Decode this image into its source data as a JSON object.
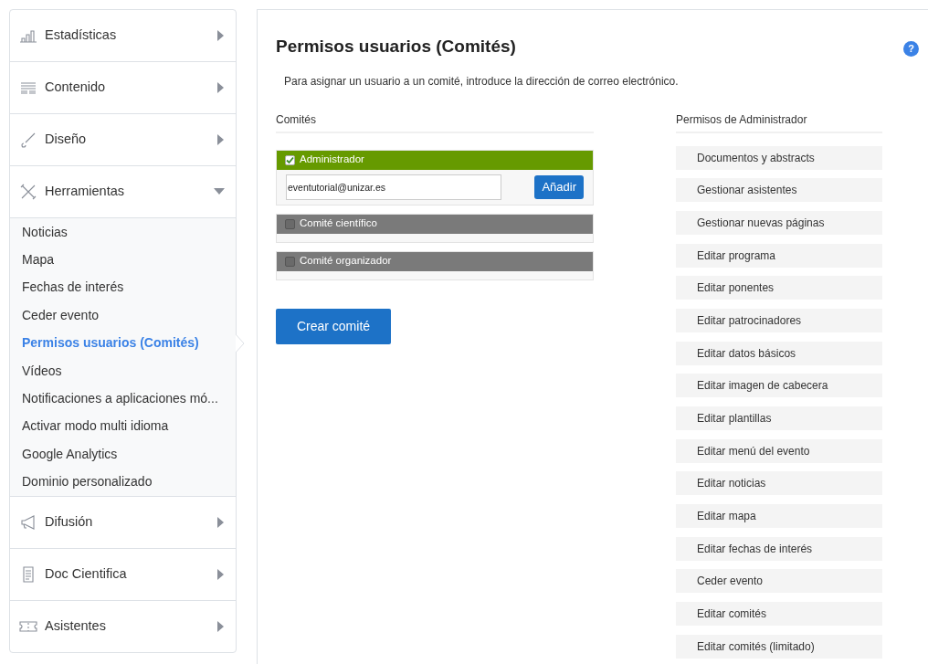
{
  "sidebar": {
    "sections": [
      {
        "label": "Estadísticas",
        "expanded": false
      },
      {
        "label": "Contenido",
        "expanded": false
      },
      {
        "label": "Diseño",
        "expanded": false
      },
      {
        "label": "Herramientas",
        "expanded": true,
        "children": [
          {
            "label": "Noticias",
            "selected": false
          },
          {
            "label": "Mapa",
            "selected": false
          },
          {
            "label": "Fechas de interés",
            "selected": false
          },
          {
            "label": "Ceder evento",
            "selected": false
          },
          {
            "label": "Permisos usuarios (Comités)",
            "selected": true
          },
          {
            "label": "Vídeos",
            "selected": false
          },
          {
            "label": "Notificaciones a aplicaciones mó...",
            "selected": false
          },
          {
            "label": "Activar modo multi idioma",
            "selected": false
          },
          {
            "label": "Google Analytics",
            "selected": false
          },
          {
            "label": "Dominio personalizado",
            "selected": false
          }
        ]
      },
      {
        "label": "Difusión",
        "expanded": false
      },
      {
        "label": "Doc Cientifica",
        "expanded": false
      },
      {
        "label": "Asistentes",
        "expanded": false
      }
    ]
  },
  "main": {
    "title": "Permisos usuarios (Comités)",
    "help": "?",
    "intro": "Para asignar un usuario a un comité, introduce la dirección de correo electrónico.",
    "committees_heading": "Comités",
    "committees": [
      {
        "name": "Administrador",
        "checked": true,
        "email": "eventutorial@unizar.es",
        "add_button": "Añadir"
      },
      {
        "name": "Comité científico",
        "checked": false
      },
      {
        "name": "Comité organizador",
        "checked": false
      }
    ],
    "create_button": "Crear comité",
    "permissions_heading": "Permisos de Administrador",
    "permissions": [
      "Documentos y abstracts",
      "Gestionar asistentes",
      "Gestionar nuevas páginas",
      "Editar programa",
      "Editar ponentes",
      "Editar patrocinadores",
      "Editar datos básicos",
      "Editar imagen de cabecera",
      "Editar plantillas",
      "Editar menú del evento",
      "Editar noticias",
      "Editar mapa",
      "Editar fechas de interés",
      "Ceder evento",
      "Editar comités",
      "Editar comités (limitado)"
    ]
  }
}
